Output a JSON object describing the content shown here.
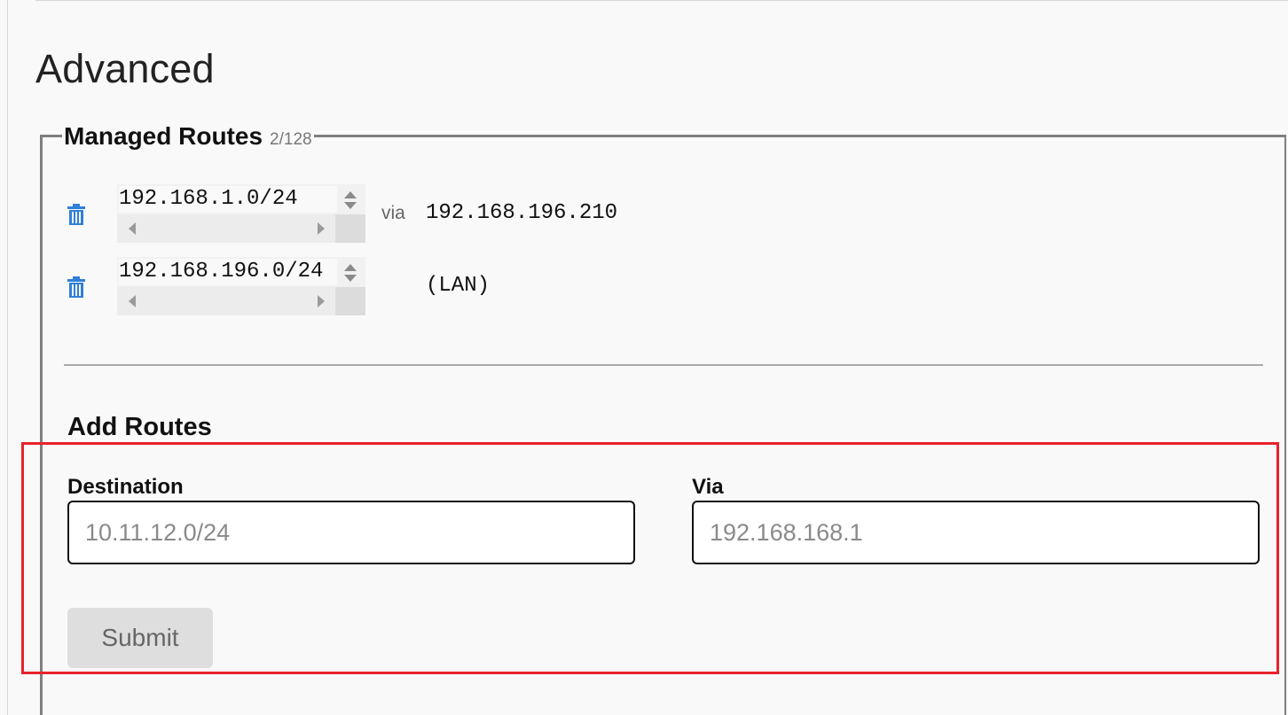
{
  "section": {
    "title": "Advanced"
  },
  "managed_routes": {
    "title": "Managed Routes",
    "count": "2/128",
    "routes": [
      {
        "target": "192.168.1.0/24",
        "via_label": "via",
        "via": "192.168.196.210",
        "delete_icon": "trash-icon"
      },
      {
        "target": "192.168.196.0/24",
        "via_label": "",
        "via": "(LAN)",
        "delete_icon": "trash-icon"
      }
    ]
  },
  "add_routes": {
    "title": "Add Routes",
    "destination": {
      "label": "Destination",
      "value": "",
      "placeholder": "10.11.12.0/24"
    },
    "via": {
      "label": "Via",
      "value": "",
      "placeholder": "192.168.168.1"
    },
    "submit_label": "Submit"
  },
  "colors": {
    "accent_icon": "#2f7fd8",
    "highlight": "#e8222c",
    "border": "#7f7f7f",
    "button_disabled_bg": "#dedede"
  }
}
